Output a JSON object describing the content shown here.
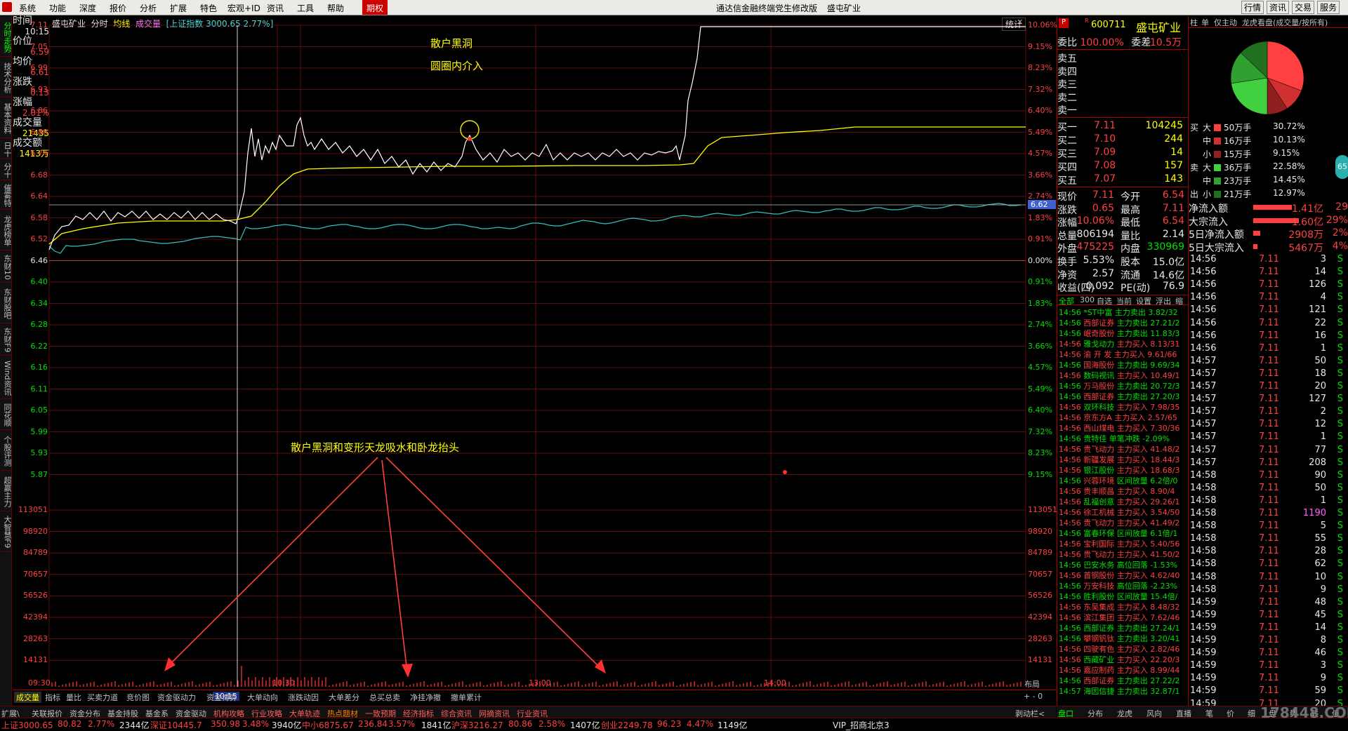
{
  "app": {
    "title": "通达信金融终端党生修改版",
    "stock": "盛屯矿业",
    "period_tab": "期权"
  },
  "menu": [
    "系统",
    "功能",
    "深度",
    "报价",
    "分析",
    "扩展",
    "特色",
    "宏观+ID",
    "资讯",
    "工具",
    "帮助"
  ],
  "top_right_btns": [
    "行情",
    "资讯",
    "交易",
    "服务"
  ],
  "left_tabs": [
    "分时走势",
    "技术分析",
    "基本资料",
    "日十",
    "分十",
    "催雾特",
    "龙虎榜单",
    "东财10",
    "东财股吧",
    "东财F9",
    "Wind资讯",
    "同花顺",
    "个股评测",
    "超赢主力",
    "大智慧F9"
  ],
  "chart": {
    "header": {
      "name": "盛屯矿业",
      "mode": "分时",
      "avg": "均线",
      "vol": "成交量",
      "index": "[上证指数 3000.65 2.77%]",
      "stat": "统计"
    },
    "info": {
      "time_label": "时间",
      "time": "10:15",
      "price_label": "价位",
      "price": "6.59",
      "avg_label": "均价",
      "avg": "6.61",
      "chg_label": "涨跌",
      "chg": "0.13",
      "pct_label": "涨幅",
      "pct": "2.01%",
      "vol_label": "成交量",
      "vol": "21435",
      "amt_label": "成交额",
      "amt": "1413万"
    },
    "annotations": {
      "a1": "散户黑洞",
      "a2": "圆圈内介入",
      "a3": "散户黑洞和变形天龙吸水和卧龙抬头"
    },
    "price_left": [
      "7.11",
      "7.05",
      "6.99",
      "6.93",
      "6.86",
      "6.80",
      "6.74",
      "6.68",
      "6.64",
      "6.58",
      "6.52",
      "6.46",
      "6.40",
      "6.34",
      "6.28",
      "6.22",
      "6.16",
      "6.11",
      "6.05",
      "5.99",
      "5.93",
      "5.87"
    ],
    "pct_right": [
      "10.06%",
      "9.15%",
      "8.23%",
      "7.32%",
      "6.40%",
      "5.49%",
      "4.57%",
      "3.66%",
      "2.74%",
      "1.83%",
      "0.91%",
      "0.00%",
      "0.91%",
      "1.83%",
      "2.74%",
      "3.66%",
      "4.57%",
      "5.49%",
      "6.40%",
      "7.32%",
      "8.23%",
      "9.15%"
    ],
    "vol_labels": [
      "113051",
      "98920",
      "84789",
      "70657",
      "56526",
      "42394",
      "28263",
      "14131"
    ],
    "time_labels": [
      "09:30",
      "10:15",
      "10:30",
      "13:00",
      "14:00"
    ],
    "cursor_price": "6.62",
    "bottom_tabs": [
      "成交量",
      "指标",
      "量比",
      "买卖力道",
      "竞价图",
      "资金驱动力",
      "资金博弈",
      "大单动向",
      "涨跌动因",
      "大单差分",
      "总买总卖",
      "净挂净撤",
      "撤单累计"
    ],
    "layout_btn": "布局"
  },
  "right": {
    "code": "600711",
    "name": "盛屯矿业",
    "ratio_label": "委比",
    "ratio": "100.00%",
    "diff_label": "委差",
    "diff": "10.5万",
    "sells": [
      "卖五",
      "卖四",
      "卖三",
      "卖二",
      "卖一"
    ],
    "buys": [
      [
        "买一",
        "7.11",
        "104245"
      ],
      [
        "买二",
        "7.10",
        "244"
      ],
      [
        "买三",
        "7.09",
        "14"
      ],
      [
        "买四",
        "7.08",
        "157"
      ],
      [
        "买五",
        "7.07",
        "143"
      ]
    ],
    "stats": [
      [
        "现价",
        "7.11",
        "今开",
        "6.54"
      ],
      [
        "涨跌",
        "0.65",
        "最高",
        "7.11"
      ],
      [
        "涨幅",
        "10.06%",
        "最低",
        "6.54"
      ],
      [
        "总量",
        "806194",
        "量比",
        "2.14"
      ],
      [
        "外盘",
        "475225",
        "内盘",
        "330969"
      ],
      [
        "换手",
        "5.53%",
        "股本",
        "15.0亿"
      ],
      [
        "净资",
        "2.57",
        "流通",
        "14.6亿"
      ],
      [
        "收益(四)",
        "0.092",
        "PE(动)",
        "76.9"
      ]
    ],
    "news_tabs": [
      "全部",
      "300",
      "自选",
      "当前",
      "设置",
      "浮出",
      "缩"
    ],
    "news": [
      [
        "14:56",
        "*ST中富",
        "主力卖出",
        "3.82/32"
      ],
      [
        "14:56",
        "西部证券",
        "主力卖出",
        "27.21/2"
      ],
      [
        "14:56",
        "岷奇股份",
        "主力卖出",
        "11.83/3"
      ],
      [
        "14:56",
        "雅戈动力",
        "主力买入",
        "8.13/31"
      ],
      [
        "14:56",
        "渝 开 发",
        "主力买入",
        "9.61/66"
      ],
      [
        "14:56",
        "国海股份",
        "主力卖出",
        "9.69/34"
      ],
      [
        "14:56",
        "数码视讯",
        "主力买入",
        "10.49/1"
      ],
      [
        "14:56",
        "万马股份",
        "主力卖出",
        "20.72/3"
      ],
      [
        "14:56",
        "西部证券",
        "主力卖出",
        "27.20/3"
      ],
      [
        "14:56",
        "双环科技",
        "主力买入",
        "7.98/35"
      ],
      [
        "14:56",
        "京东方A",
        "主力买入",
        "2.57/65"
      ],
      [
        "14:56",
        "西山煤电",
        "主力买入",
        "7.30/36"
      ],
      [
        "14:56",
        "贵特佳",
        "单笔冲跌",
        "-2.09%"
      ],
      [
        "14:56",
        "贵飞动力",
        "主力买入",
        "41.48/2"
      ],
      [
        "14:56",
        "新疆发展",
        "主力买入",
        "18.44/3"
      ],
      [
        "14:56",
        "银江股份",
        "主力买入",
        "18.68/3"
      ],
      [
        "14:56",
        "兴蓉环境",
        "区间放量",
        "6.2倍/0"
      ],
      [
        "14:56",
        "贵丰顺昌",
        "主力买入",
        "8.90/4"
      ],
      [
        "14:56",
        "乱福创意",
        "主力买入",
        "29.26/1"
      ],
      [
        "14:56",
        "徐工机械",
        "主力买入",
        "3.54/50"
      ],
      [
        "14:56",
        "贵飞动力",
        "主力买入",
        "41.49/2"
      ],
      [
        "14:56",
        "富春环保",
        "区间放量",
        "6.1倍/1"
      ],
      [
        "14:56",
        "宝利国际",
        "主力买入",
        "5.40/56"
      ],
      [
        "14:56",
        "贵飞动力",
        "主力买入",
        "41.50/2"
      ],
      [
        "14:56",
        "巴安水务",
        "高位回落",
        "-1.53%"
      ],
      [
        "14:56",
        "首钢股份",
        "主力买入",
        "4.62/40"
      ],
      [
        "14:56",
        "万安科技",
        "高位回落",
        "-2.23%"
      ],
      [
        "14:56",
        "胜利股份",
        "区间放量",
        "15.4倍/"
      ],
      [
        "14:56",
        "东吴集成",
        "主力买入",
        "8.48/32"
      ],
      [
        "14:56",
        "滨江集团",
        "主力买入",
        "7.62/46"
      ],
      [
        "14:56",
        "西部证券",
        "主力卖出",
        "27.24/1"
      ],
      [
        "14:56",
        "攀钢钒钛",
        "主力卖出",
        "3.20/41"
      ],
      [
        "14:56",
        "四驶有色",
        "主力买入",
        "2.82/46"
      ],
      [
        "14:56",
        "西藏矿业",
        "主力买入",
        "22.20/3"
      ],
      [
        "14:56",
        "嘉应制药",
        "主力买入",
        "8.99/44"
      ],
      [
        "14:56",
        "西部证券",
        "主力卖出",
        "27.22/2"
      ],
      [
        "14:57",
        "海因信捷",
        "主力卖出",
        "32.87/1"
      ]
    ]
  },
  "farright": {
    "tabs": [
      "柱",
      "单",
      "仅主动",
      "龙虎看盘(成交量/按所有)"
    ],
    "pie": [
      {
        "label": "大",
        "hand": "50万手",
        "pct": "30.72%",
        "color": "#ff4040",
        "side": "买"
      },
      {
        "label": "中",
        "hand": "16万手",
        "pct": "10.13%",
        "color": "#d03030",
        "side": "买"
      },
      {
        "label": "小",
        "hand": "15万手",
        "pct": "9.15%",
        "color": "#902020",
        "side": "买"
      },
      {
        "label": "大",
        "hand": "36万手",
        "pct": "22.58%",
        "color": "#40d040",
        "side": "卖"
      },
      {
        "label": "中",
        "hand": "23万手",
        "pct": "14.45%",
        "color": "#30a030",
        "side": "卖"
      },
      {
        "label": "小",
        "hand": "21万手",
        "pct": "12.97%",
        "color": "#207020",
        "side": "出"
      }
    ],
    "flows": [
      [
        "净流入额",
        "1.41亿",
        "29"
      ],
      [
        "大宗流入",
        "1.60亿",
        "29%"
      ],
      [
        "5日净流入额",
        "2908万",
        "2%"
      ],
      [
        "5日大宗流入",
        "5467万",
        "4%"
      ]
    ],
    "ticks": [
      [
        "14:56",
        "7.11",
        "3",
        "S"
      ],
      [
        "14:56",
        "7.11",
        "14",
        "S"
      ],
      [
        "14:56",
        "7.11",
        "126",
        "S"
      ],
      [
        "14:56",
        "7.11",
        "4",
        "S"
      ],
      [
        "14:56",
        "7.11",
        "121",
        "S"
      ],
      [
        "14:56",
        "7.11",
        "22",
        "S"
      ],
      [
        "14:56",
        "7.11",
        "16",
        "S"
      ],
      [
        "14:56",
        "7.11",
        "1",
        "S"
      ],
      [
        "14:57",
        "7.11",
        "50",
        "S"
      ],
      [
        "14:57",
        "7.11",
        "18",
        "S"
      ],
      [
        "14:57",
        "7.11",
        "20",
        "S"
      ],
      [
        "14:57",
        "7.11",
        "127",
        "S"
      ],
      [
        "14:57",
        "7.11",
        "2",
        "S"
      ],
      [
        "14:57",
        "7.11",
        "12",
        "S"
      ],
      [
        "14:57",
        "7.11",
        "1",
        "S"
      ],
      [
        "14:57",
        "7.11",
        "77",
        "S"
      ],
      [
        "14:57",
        "7.11",
        "208",
        "S"
      ],
      [
        "14:58",
        "7.11",
        "90",
        "S"
      ],
      [
        "14:58",
        "7.11",
        "50",
        "S"
      ],
      [
        "14:58",
        "7.11",
        "1",
        "S"
      ],
      [
        "14:58",
        "7.11",
        "1190",
        "S"
      ],
      [
        "14:58",
        "7.11",
        "5",
        "S"
      ],
      [
        "14:58",
        "7.11",
        "55",
        "S"
      ],
      [
        "14:58",
        "7.11",
        "28",
        "S"
      ],
      [
        "14:58",
        "7.11",
        "62",
        "S"
      ],
      [
        "14:58",
        "7.11",
        "10",
        "S"
      ],
      [
        "14:58",
        "7.11",
        "9",
        "S"
      ],
      [
        "14:59",
        "7.11",
        "48",
        "S"
      ],
      [
        "14:59",
        "7.11",
        "45",
        "S"
      ],
      [
        "14:59",
        "7.11",
        "14",
        "S"
      ],
      [
        "14:59",
        "7.11",
        "8",
        "S"
      ],
      [
        "14:59",
        "7.11",
        "46",
        "S"
      ],
      [
        "14:59",
        "7.11",
        "3",
        "S"
      ],
      [
        "14:59",
        "7.11",
        "9",
        "S"
      ],
      [
        "14:59",
        "7.11",
        "59",
        "S"
      ],
      [
        "14:59",
        "7.11",
        "20",
        "S"
      ]
    ],
    "bottom_tabs": [
      "盘口",
      "分布",
      "龙虎",
      "风向",
      "直播",
      "笔",
      "价",
      "细",
      "盘",
      "势",
      "联",
      "值",
      "主"
    ],
    "badge": "65"
  },
  "bottom_func": [
    "扩展\\",
    "关联报价",
    "资金分布",
    "基金持股",
    "基金系",
    "资金驱动",
    "机构攻略",
    "行业攻略",
    "大单轨迹",
    "热点题材",
    "一致预期",
    "经济指标",
    "综合资讯",
    "网摘资讯",
    "行业资讯"
  ],
  "status": {
    "sh": "上证3000.65",
    "sh_chg": "80.82",
    "sh_pct": "2.77%",
    "sh_amt": "2344亿",
    "sz": "深证10445.7",
    "sz_chg": "350.98",
    "sz_pct": "3.48%",
    "sz_amt": "3940亿",
    "zx": "中小6875.67",
    "zx_chg": "236.84",
    "zx_pct": "3.57%",
    "zx_amt": "1841亿",
    "hs": "沪深3216.27",
    "hs_chg": "80.86",
    "hs_pct": "2.58%",
    "hs_amt": "1407亿",
    "cy": "创业2249.78",
    "cy_chg": "96.23",
    "cy_pct": "4.47%",
    "cy_amt": "1149亿",
    "vip": "VIP_招商北京3",
    "right_tab": "剥动栏<",
    "watermark": "178448.COM"
  }
}
